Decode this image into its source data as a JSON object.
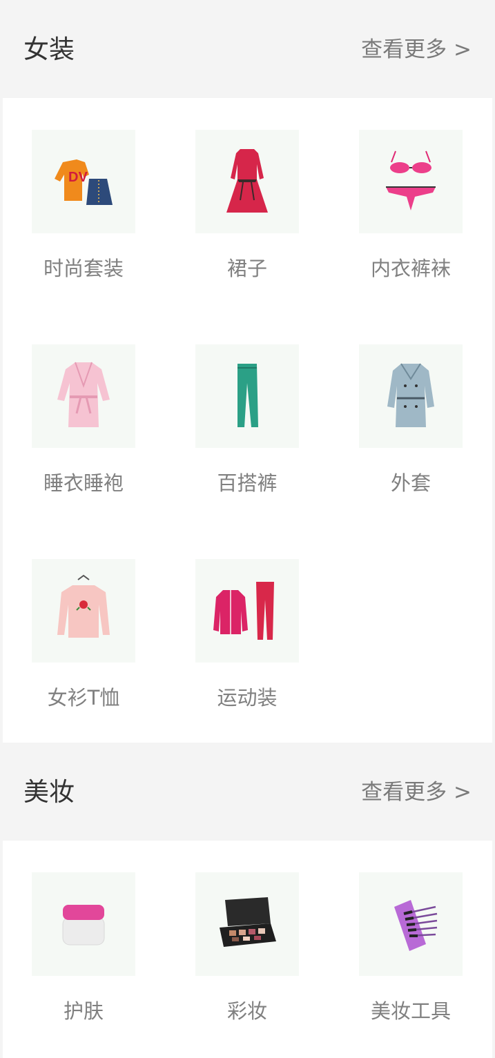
{
  "sections": [
    {
      "title": "女装",
      "more": "查看更多 >",
      "items": [
        {
          "label": "时尚套装",
          "icon": "outfit-icon"
        },
        {
          "label": "裙子",
          "icon": "dress-icon"
        },
        {
          "label": "内衣裤袜",
          "icon": "lingerie-icon"
        },
        {
          "label": "睡衣睡袍",
          "icon": "robe-icon"
        },
        {
          "label": "百搭裤",
          "icon": "pants-icon"
        },
        {
          "label": "外套",
          "icon": "trench-coat-icon"
        },
        {
          "label": "女衫T恤",
          "icon": "tshirt-icon"
        },
        {
          "label": "运动装",
          "icon": "tracksuit-icon"
        }
      ]
    },
    {
      "title": "美妆",
      "more": "查看更多 >",
      "items": [
        {
          "label": "护肤",
          "icon": "cream-jar-icon"
        },
        {
          "label": "彩妆",
          "icon": "eyeshadow-palette-icon"
        },
        {
          "label": "美妆工具",
          "icon": "makeup-brushes-icon"
        }
      ]
    }
  ],
  "colors": {
    "background": "#f4f4f4",
    "card": "#ffffff",
    "thumb_bg": "#f5f9f5",
    "title": "#333333",
    "muted": "#7a7a7a"
  }
}
